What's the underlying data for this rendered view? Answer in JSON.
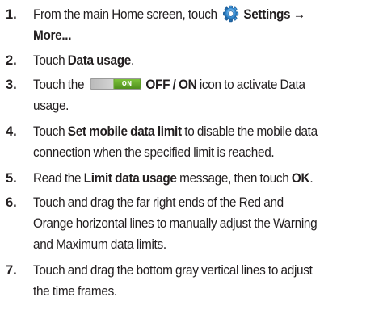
{
  "steps": [
    {
      "number": "1.",
      "line1_prefix": "From the main Home screen, touch",
      "line1_bold": "Settings →",
      "line2_bold": "More...",
      "icon": "settings-gear-icon"
    },
    {
      "number": "2.",
      "prefix": "Touch ",
      "bold": "Data usage",
      "suffix": "."
    },
    {
      "number": "3.",
      "prefix": "Touch the",
      "toggle_label": "ON",
      "bold": "OFF / ON",
      "suffix": " icon to activate Data",
      "line2": "usage."
    },
    {
      "number": "4.",
      "prefix": "Touch ",
      "bold": "Set mobile data limit",
      "suffix": " to disable the mobile data",
      "line2": "connection when the specified limit is reached."
    },
    {
      "number": "5.",
      "prefix": "Read the ",
      "bold": "Limit data usage",
      "middle": " message, then touch ",
      "bold2": "OK",
      "suffix": "."
    },
    {
      "number": "6.",
      "line1": "Touch and drag the far right ends of the Red and",
      "line2": "Orange horizontal lines to manually adjust the Warning",
      "line3": "and Maximum data limits."
    },
    {
      "number": "7.",
      "line1": "Touch and drag the bottom gray vertical lines to adjust",
      "line2": "the time frames."
    }
  ],
  "colors": {
    "text": "#231f20",
    "toggle_on": "#5b9a25",
    "gear": "#2f86c9"
  }
}
